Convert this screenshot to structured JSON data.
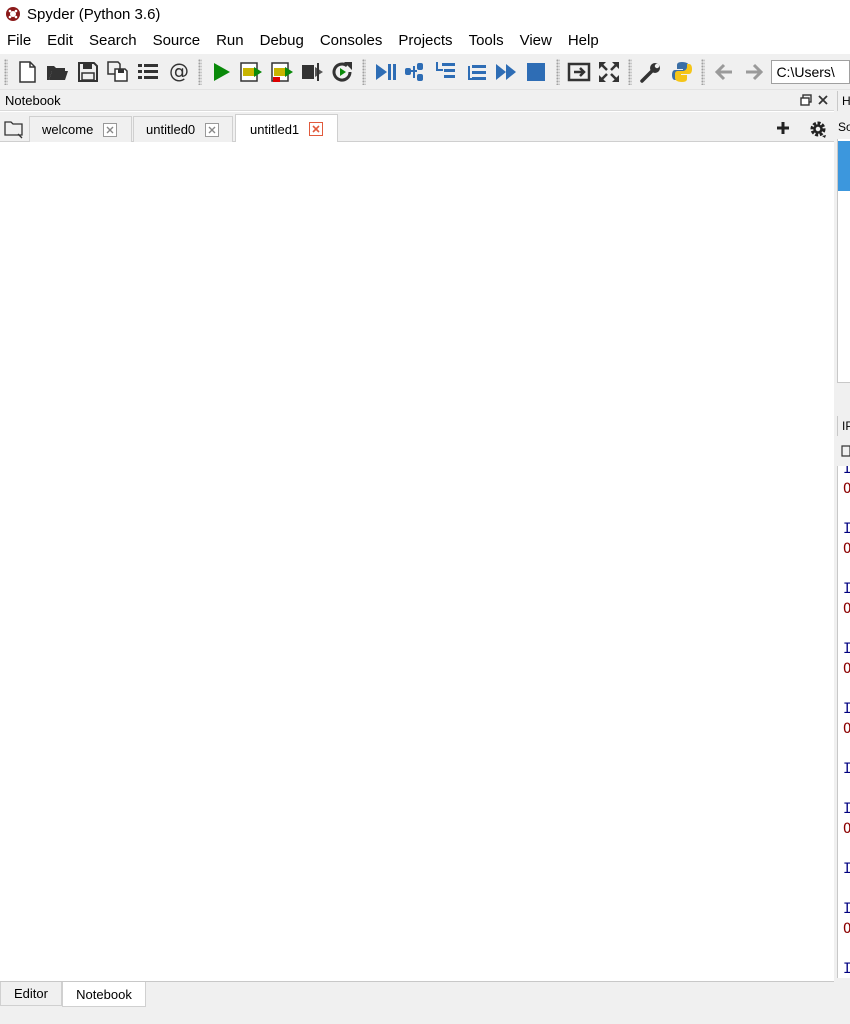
{
  "window": {
    "title": "Spyder (Python 3.6)"
  },
  "menu": [
    "File",
    "Edit",
    "Search",
    "Source",
    "Run",
    "Debug",
    "Consoles",
    "Projects",
    "Tools",
    "View",
    "Help"
  ],
  "toolbar": {
    "path_value": "C:\\Users\\"
  },
  "notebook_pane": {
    "title": "Notebook",
    "tabs": [
      {
        "label": "welcome",
        "active": false
      },
      {
        "label": "untitled0",
        "active": false
      },
      {
        "label": "untitled1",
        "active": true
      }
    ]
  },
  "bottom_tabs": [
    {
      "label": "Editor",
      "active": false
    },
    {
      "label": "Notebook",
      "active": true
    }
  ],
  "right_panes": {
    "help_header": "H",
    "help_source_label": "So",
    "console_header": "IP",
    "console_lines": [
      "I",
      "O",
      "I",
      "O",
      "I",
      "O",
      "I",
      "O",
      "I",
      "O",
      "I",
      "I",
      "O",
      "I",
      "I",
      "O",
      "I"
    ]
  },
  "colors": {
    "run_green": "#0a8a0a",
    "accent_blue": "#2e6db5",
    "close_red": "#e15a3c",
    "help_blue": "#3c97dd"
  }
}
